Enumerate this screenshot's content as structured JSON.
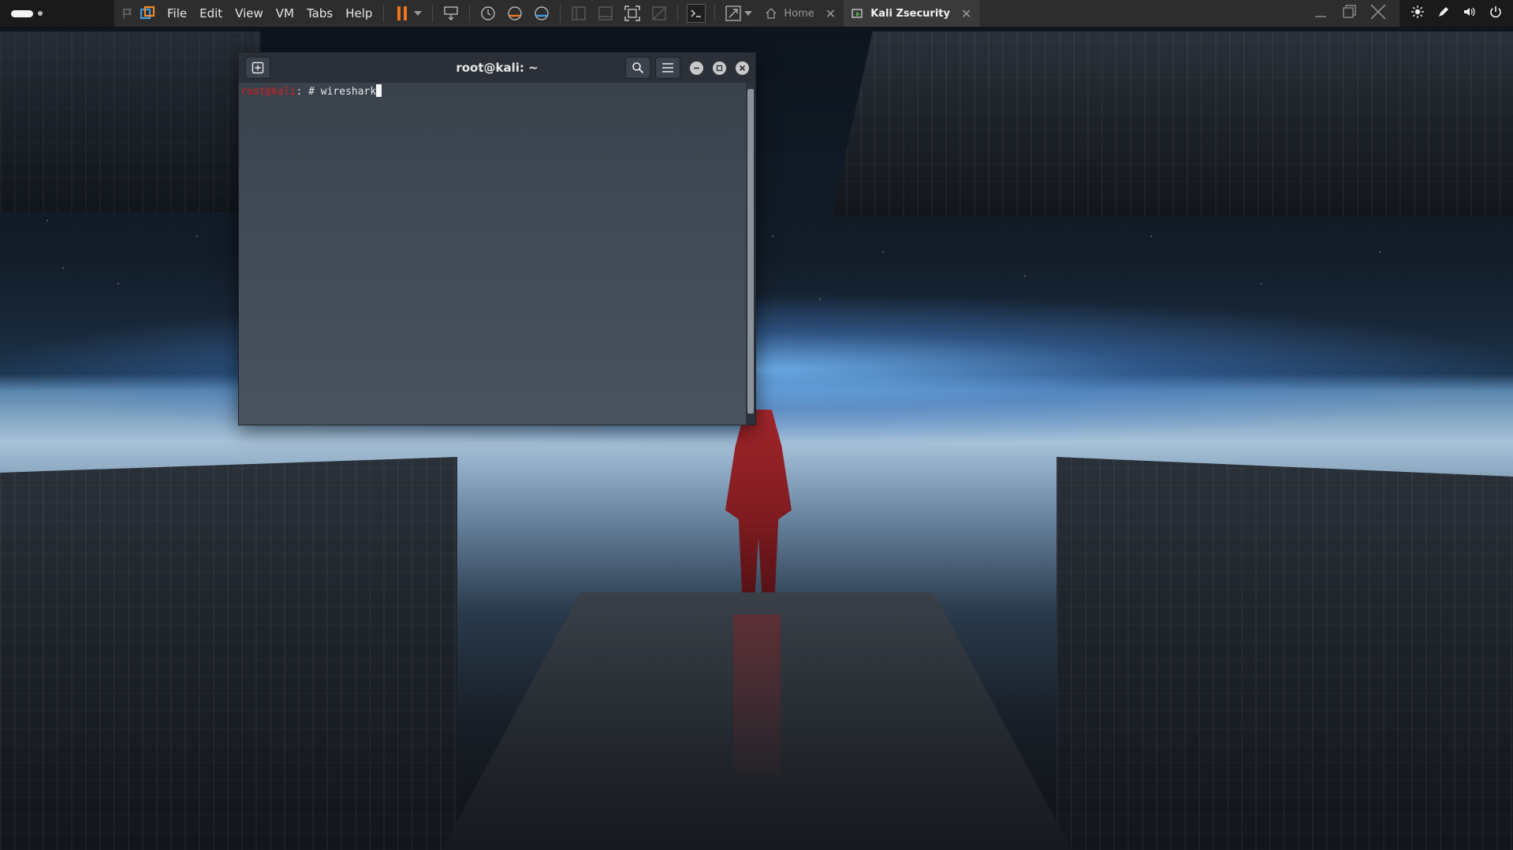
{
  "vmware": {
    "menu": [
      "File",
      "Edit",
      "View",
      "VM",
      "Tabs",
      "Help"
    ],
    "tabs": [
      {
        "label": "Home",
        "icon": "home-icon",
        "active": false
      },
      {
        "label": "Kali Zsecurity",
        "icon": "vm-icon",
        "active": true
      }
    ]
  },
  "terminal": {
    "title": "root@kali: ~",
    "prompt_user": "root@kali",
    "prompt_suffix": ": # ",
    "command": "wireshark"
  },
  "colors": {
    "prompt_user": "#d11f1f",
    "pause_button": "#f0761e",
    "topbar": "#2d2d2d"
  }
}
